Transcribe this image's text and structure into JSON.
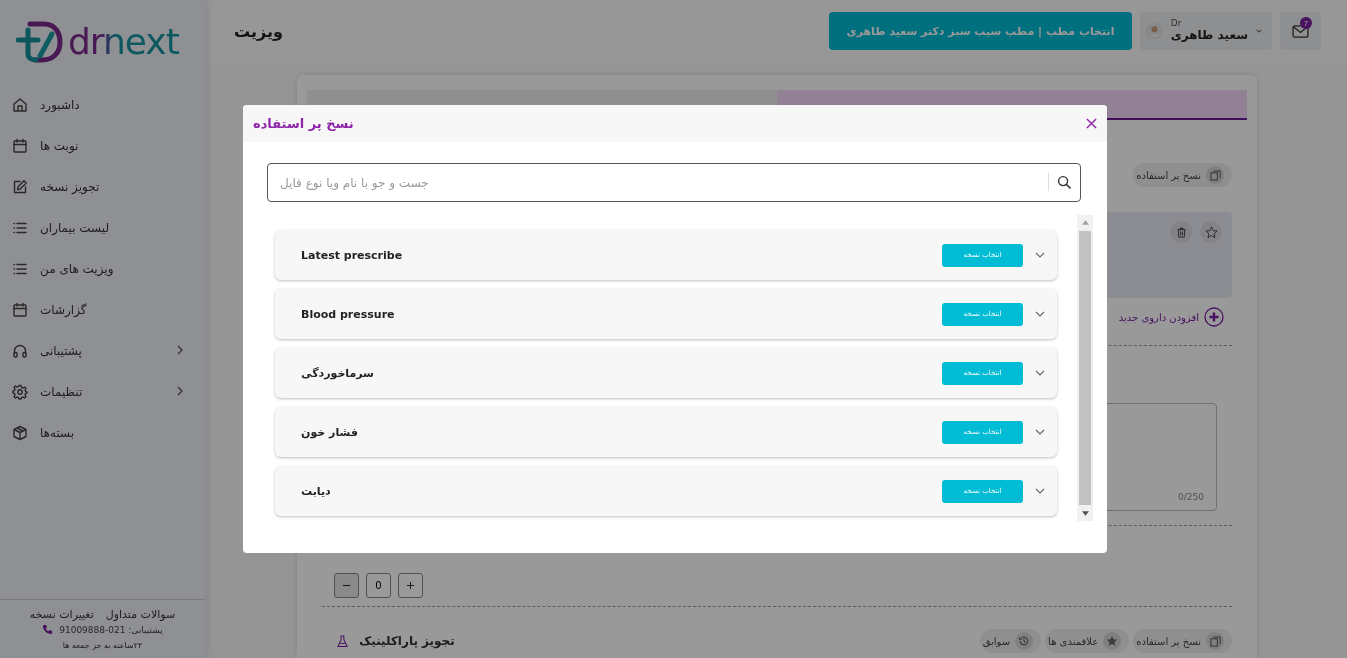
{
  "logo": {
    "text": "drnext"
  },
  "sidebar": {
    "items": [
      {
        "kind": "home",
        "label": "داشبورد",
        "expandable": false
      },
      {
        "kind": "calendar",
        "label": "نوبت ها",
        "expandable": false
      },
      {
        "kind": "edit",
        "label": "تجویز نسخه",
        "expandable": false
      },
      {
        "kind": "list",
        "label": "لیست بیماران",
        "expandable": false
      },
      {
        "kind": "list",
        "label": "ویزیت های من",
        "expandable": false
      },
      {
        "kind": "calendar",
        "label": "گزارشات",
        "expandable": false
      },
      {
        "kind": "headphones",
        "label": "پشتیبانی",
        "expandable": true
      },
      {
        "kind": "gear",
        "label": "تنظیمات",
        "expandable": true
      },
      {
        "kind": "box",
        "label": "بسته‌ها",
        "expandable": false
      }
    ],
    "footer": {
      "links": [
        "سوالات متداول",
        "تغییرات نسخه"
      ],
      "phone": "پشتیبانی: 021-91009888",
      "hours": "۲۴ساعته به جز جمعه ها"
    }
  },
  "header": {
    "title": "ویزیت",
    "clinic_button": "انتخاب مطب | مطب سیب سبز دکتر سعید طاهری",
    "user": {
      "prefix": "Dr",
      "name": "سعید طاهری"
    },
    "mail_badge": "7"
  },
  "visit": {
    "steps": [
      {
        "selected": false
      },
      {
        "selected": true
      }
    ],
    "top_chip": "نسخ پر استفاده",
    "add_drug": "افزودن داروی جدید",
    "note_counter": "0/250",
    "quantity": "0",
    "paraclinic_title": "تجویز پاراکلینیک",
    "bottom_chips": [
      {
        "kind": "copy",
        "label": "نسخ پر استفاده"
      },
      {
        "kind": "star",
        "label": "علاقمندی ها"
      },
      {
        "kind": "history",
        "label": "سوابق"
      }
    ]
  },
  "modal": {
    "title": "نسخ پر استفاده",
    "search": {
      "placeholder": "جست و جو با نام ویا نوع فایل"
    },
    "prescriptions": [
      {
        "name": "Latest prescribe",
        "button": "انتخاب نسخه"
      },
      {
        "name": "Blood pressure",
        "button": "انتخاب نسخه"
      },
      {
        "name": "سرماخوردگی",
        "button": "انتخاب نسخه"
      },
      {
        "name": "فشار خون",
        "button": "انتخاب نسخه"
      },
      {
        "name": "دیابت",
        "button": "انتخاب نسخه"
      }
    ]
  }
}
